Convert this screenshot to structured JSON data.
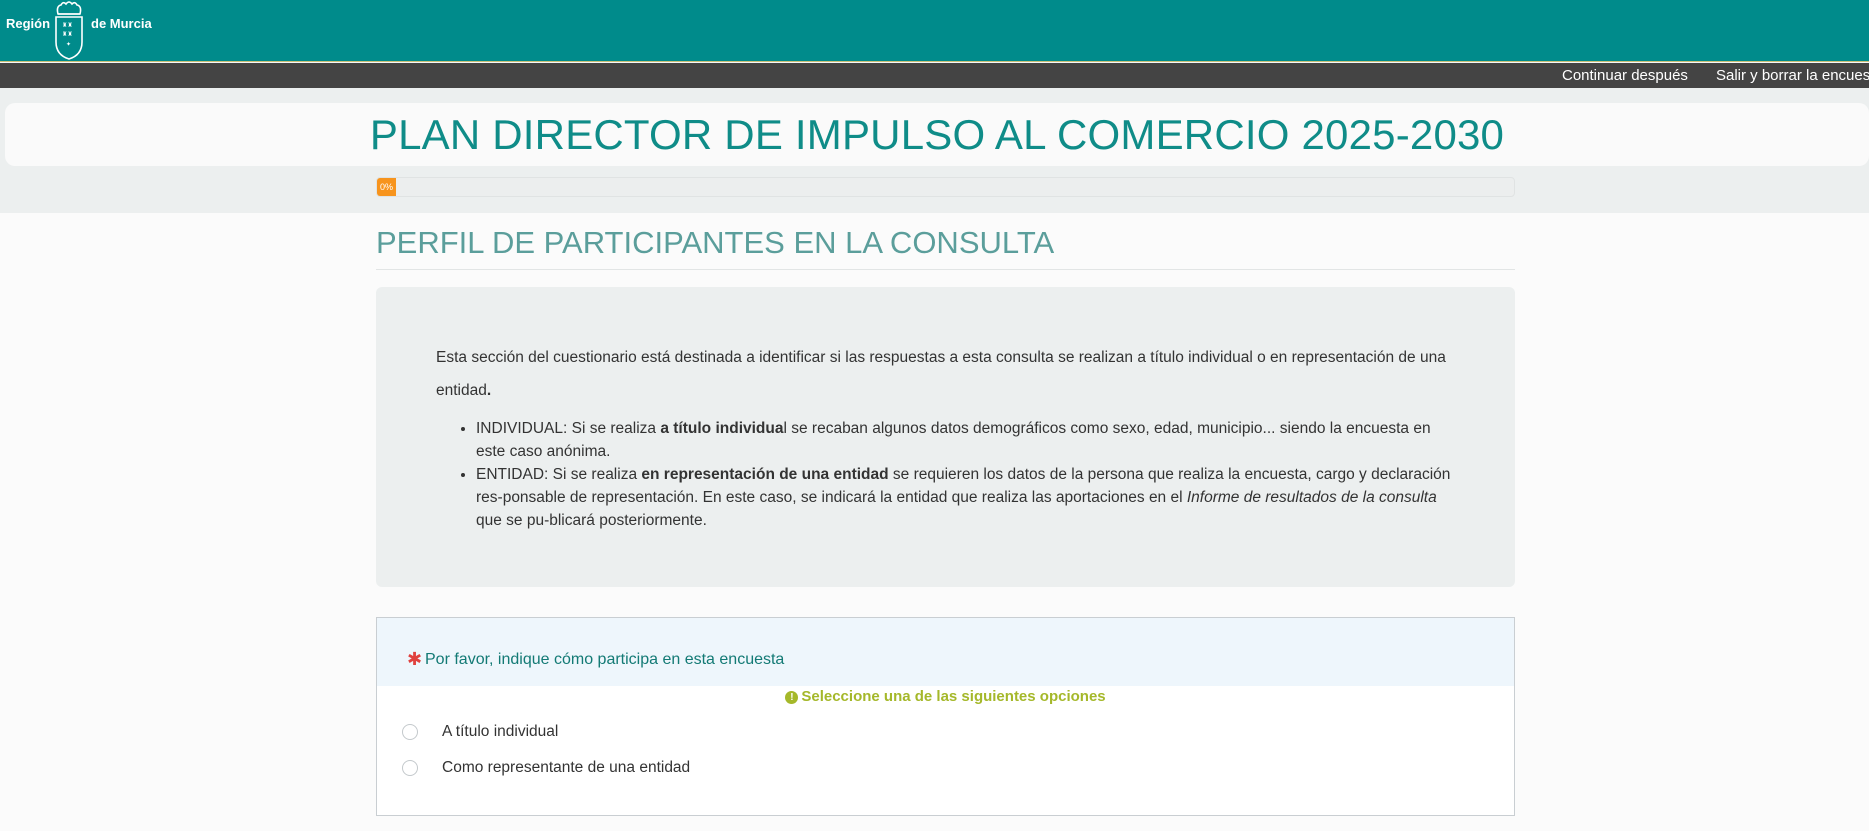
{
  "header": {
    "logo_text_left": "Región",
    "logo_text_right": "de Murcia",
    "brand_color": "#008b8b"
  },
  "nav": {
    "continue_later": "Continuar después",
    "exit_and_clear": "Salir y borrar la encuesta"
  },
  "survey": {
    "title": "PLAN DIRECTOR DE IMPULSO AL COMERCIO 2025-2030",
    "progress_label": "0%",
    "progress_value": 0
  },
  "group": {
    "title": "PERFIL DE PARTICIPANTES EN LA CONSULTA",
    "intro_text": "Esta sección del cuestionario está destinada a identificar si las respuestas a esta consulta se realizan a título individual o en representación de una entidad",
    "intro_end": ".",
    "bullets": [
      {
        "before": "INDIVIDUAL: Si se realiza ",
        "bold": "a título individua",
        "after": "l se recaban algunos datos demográficos como sexo, edad, municipio... siendo la encuesta en este caso anónima."
      },
      {
        "before": "ENTIDAD: Si se realiza ",
        "bold": "en representación de una entidad",
        "middle": " se requieren los datos de la persona que realiza la encuesta, cargo y declaración res-ponsable de representación. En este caso, se indicará la entidad que realiza las aportaciones en el ",
        "italic": "Informe de resultados de la consulta",
        "after": " que se pu-blicará posteriormente."
      }
    ]
  },
  "question": {
    "mandatory_mark": "✱",
    "text": "Por favor, indique cómo participa en esta encuesta",
    "tip_icon": "!",
    "tip": "Seleccione una de las siguientes opciones",
    "options": [
      "A título individual",
      "Como representante de una entidad"
    ]
  }
}
